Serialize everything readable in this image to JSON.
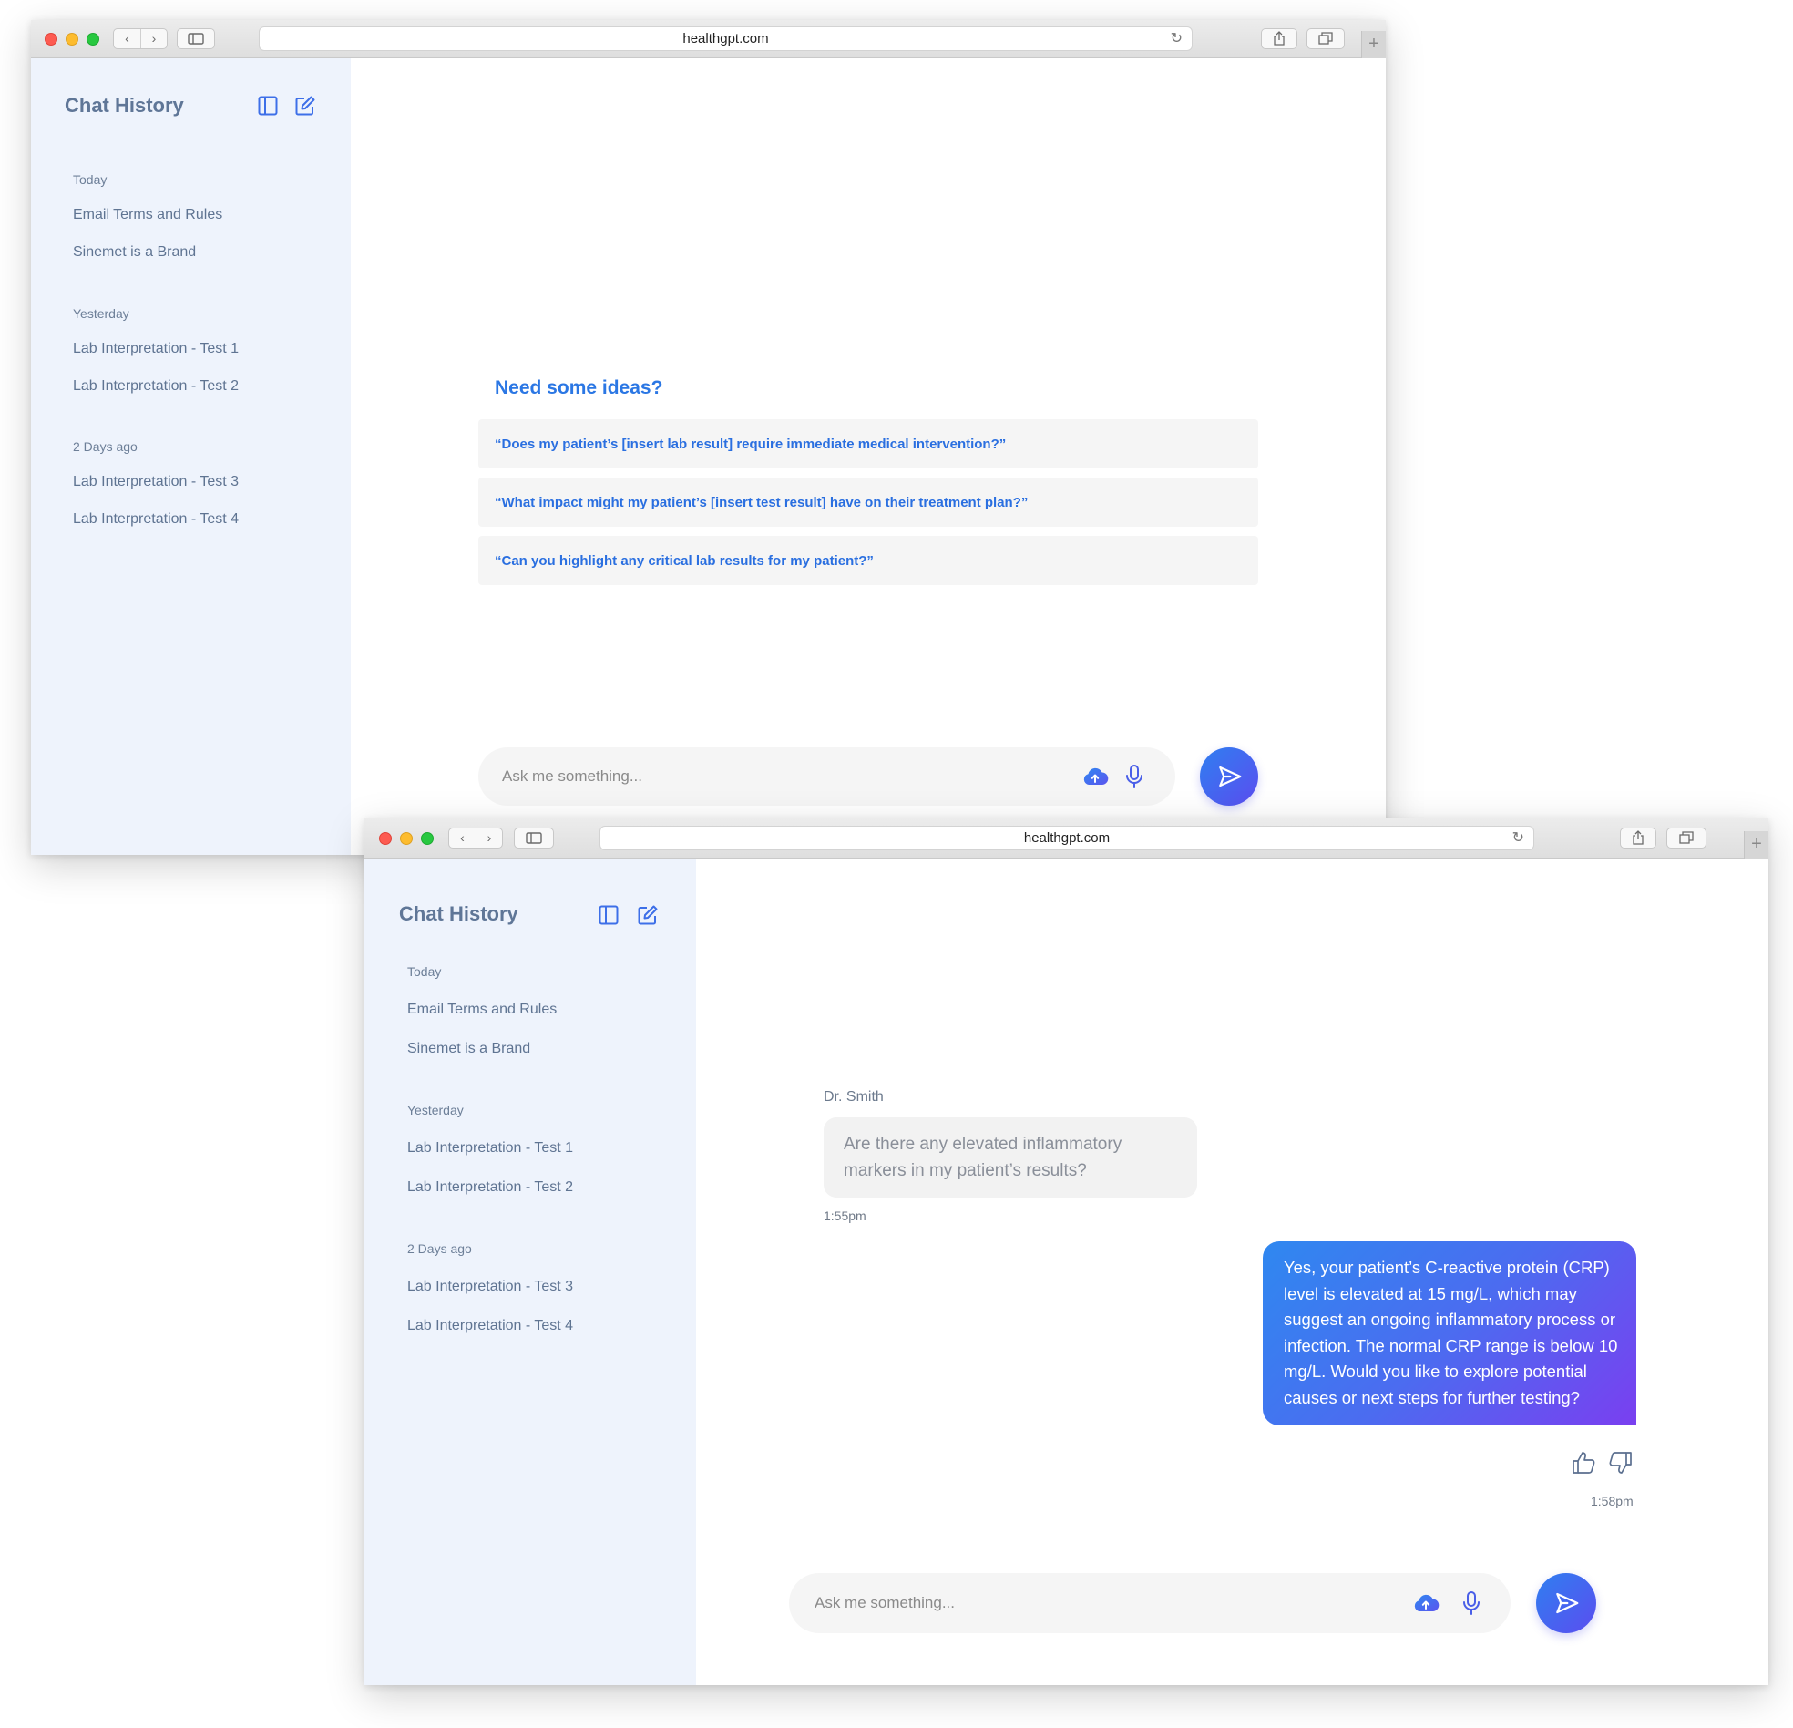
{
  "window1": {
    "url": "healthgpt.com",
    "sidebar": {
      "title": "Chat History",
      "groups": [
        {
          "label": "Today",
          "items": [
            "Email Terms and Rules",
            "Sinemet is a Brand"
          ]
        },
        {
          "label": "Yesterday",
          "items": [
            "Lab Interpretation - Test 1",
            "Lab Interpretation - Test 2"
          ]
        },
        {
          "label": "2 Days ago",
          "items": [
            "Lab Interpretation - Test 3",
            "Lab Interpretation - Test 4"
          ]
        }
      ]
    },
    "ideas": {
      "title": "Need some ideas?",
      "suggestions": [
        "“Does my patient’s [insert lab result] require immediate medical intervention?”",
        "“What impact might my patient’s [insert test result] have on their treatment plan?”",
        "“Can you highlight any critical lab results for my patient?”"
      ]
    },
    "input": {
      "placeholder": "Ask me something..."
    }
  },
  "window2": {
    "url": "healthgpt.com",
    "sidebar": {
      "title": "Chat History",
      "groups": [
        {
          "label": "Today",
          "items": [
            "Email Terms and Rules",
            "Sinemet is a Brand"
          ]
        },
        {
          "label": "Yesterday",
          "items": [
            "Lab Interpretation - Test 1",
            "Lab Interpretation - Test 2"
          ]
        },
        {
          "label": "2 Days ago",
          "items": [
            "Lab Interpretation - Test 3",
            "Lab Interpretation - Test 4"
          ]
        }
      ]
    },
    "chat": {
      "sender": "Dr. Smith",
      "question": "Are there any elevated inflammatory markers in my patient’s results?",
      "question_time": "1:55pm",
      "answer": "Yes, your patient’s C-reactive protein (CRP) level is elevated at 15 mg/L, which may suggest an ongoing inflammatory process or infection. The normal CRP range is below 10 mg/L. Would you like to explore potential causes or next steps for further testing?",
      "answer_time": "1:58pm"
    },
    "input": {
      "placeholder": "Ask me something..."
    }
  },
  "icons": {
    "sidebar_toggle": "sidebar-toggle-icon",
    "new_chat": "edit-icon",
    "upload": "cloud-upload-icon",
    "mic": "microphone-icon",
    "send": "send-icon",
    "thumbs_up": "thumbs-up-icon",
    "thumbs_down": "thumbs-down-icon"
  },
  "colors": {
    "sidebar_bg": "#eef3fc",
    "accent": "#2b77e4",
    "accent_gradient_end": "#7a3ff0",
    "icon_blue": "#3d6fe8"
  }
}
